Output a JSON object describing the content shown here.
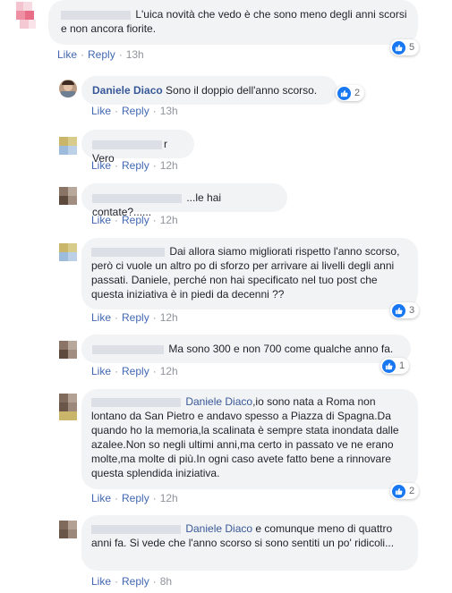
{
  "actions": {
    "like": "Like",
    "reply": "Reply",
    "separator": "·"
  },
  "comments": [
    {
      "text": "L'uica novità che vedo è che sono meno degli anni scorsi e non ancora fiorite.",
      "time": "13h",
      "reactions": "5"
    },
    {
      "author": "Daniele Diaco",
      "text": "Sono il doppio dell'anno scorso.",
      "time": "13h",
      "reactions": "2"
    },
    {
      "name_tail": "r",
      "text": "Vero",
      "time": "12h"
    },
    {
      "text": "...le hai contate?......",
      "time": "12h"
    },
    {
      "text": "Dai allora siamo migliorati rispetto l'anno scorso, però ci vuole un altro po di sforzo per arrivare ai livelli degli anni passati. Daniele, perché non hai specificato nel tuo post che questa iniziativa è in piedi da decenni ??",
      "time": "12h",
      "reactions": "3"
    },
    {
      "text": "Ma sono 300 e non 700 come qualche anno fa.",
      "time": "12h",
      "reactions": "1"
    },
    {
      "tag": "Daniele Diaco",
      "text": ",io sono nata a Roma non lontano da San Pietro e andavo spesso a Piazza di Spagna.Da quando ho la memoria,la scalinata è sempre stata inondata dalle azalee.Non so negli ultimi anni,ma certo in passato ve ne erano molte,ma molte di più.In ogni caso avete fatto bene a rinnovare questa splendida iniziativa.",
      "time": "12h",
      "reactions": "2"
    },
    {
      "tag": "Daniele Diaco",
      "text": " e comunque meno di quattro anni fa. Si vede che l'anno scorso si sono sentiti un po' ridicoli...",
      "time": "8h"
    }
  ],
  "colors": {
    "link": "#4267b2",
    "name": "#385898",
    "bubble": "#f2f3f5",
    "like": "#1877f2"
  },
  "icons": {
    "like": "thumbs-up-icon"
  }
}
